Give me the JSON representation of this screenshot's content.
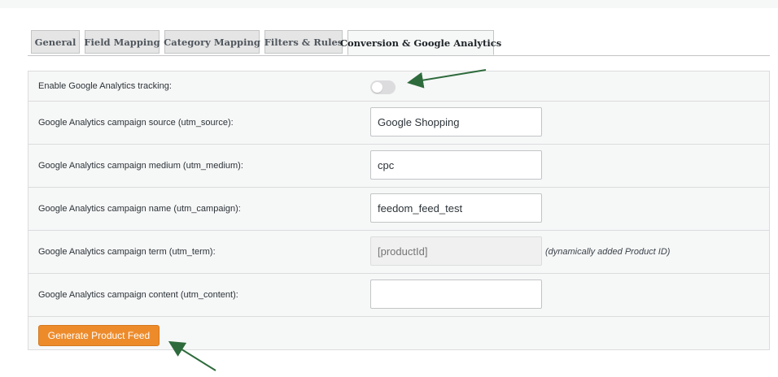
{
  "tabs": [
    {
      "label": "General",
      "active": false
    },
    {
      "label": "Field Mapping",
      "active": false
    },
    {
      "label": "Category Mapping",
      "active": false
    },
    {
      "label": "Filters & Rules",
      "active": false
    },
    {
      "label": "Conversion & Google Analytics",
      "active": true
    }
  ],
  "settings": {
    "tracking": {
      "label": "Enable Google Analytics tracking:",
      "enabled": false
    },
    "source": {
      "label": "Google Analytics campaign source (utm_source):",
      "value": "Google Shopping"
    },
    "medium": {
      "label": "Google Analytics campaign medium (utm_medium):",
      "value": "cpc"
    },
    "campaign": {
      "label": "Google Analytics campaign name (utm_campaign):",
      "value": "feedom_feed_test"
    },
    "term": {
      "label": "Google Analytics campaign term (utm_term):",
      "placeholder": "[productId]",
      "hint": "(dynamically added Product ID)"
    },
    "content": {
      "label": "Google Analytics campaign content (utm_content):",
      "value": ""
    }
  },
  "actions": {
    "generate_label": "Generate Product Feed"
  },
  "colors": {
    "accent": "#ed8b2b",
    "arrow": "#2e6b3c",
    "toggle_off": "#dcdcde"
  }
}
